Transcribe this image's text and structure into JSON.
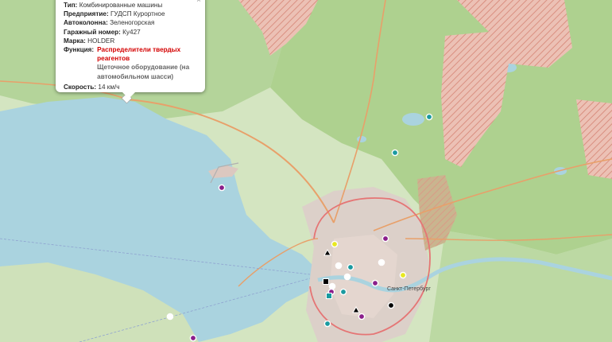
{
  "popup": {
    "close_label": "×",
    "rows": [
      {
        "label": "Тип:",
        "value": "Комбинированные машины"
      },
      {
        "label": "Предприятие:",
        "value": "ГУДСП Курортное"
      },
      {
        "label": "Автоколонна:",
        "value": "Зеленогорская"
      },
      {
        "label": "Гаражный номер:",
        "value": "Ку427"
      },
      {
        "label": "Марка:",
        "value": "HOLDER"
      }
    ],
    "function_label": "Функция:",
    "function_values": [
      "Распределители твердых реагентов",
      "Щеточное оборудование (на автомобильном шасси)"
    ],
    "speed_label": "Скорость:",
    "speed_value": "14 км/ч"
  },
  "map": {
    "city_label": "Санкт-Петербург",
    "colors": {
      "water": "#a9d0e6",
      "land": "#d9e8c8",
      "forest": "#a7cf8a",
      "urban": "#d8c8c2",
      "reserve": "#e9b7ad",
      "road": "#e5a06b",
      "highway": "#e27575"
    },
    "markers": [
      {
        "shape": "circle",
        "color": "#8b1f8b"
      },
      {
        "shape": "circle",
        "color": "#e8e820"
      },
      {
        "shape": "circle",
        "color": "#1a9aa0"
      },
      {
        "shape": "circle",
        "color": "#000000"
      },
      {
        "shape": "circle",
        "color": "#ffffff"
      },
      {
        "shape": "triangle",
        "color": "#000000"
      },
      {
        "shape": "square",
        "color": "#000000"
      },
      {
        "shape": "square",
        "color": "#1a9aa0"
      }
    ]
  }
}
